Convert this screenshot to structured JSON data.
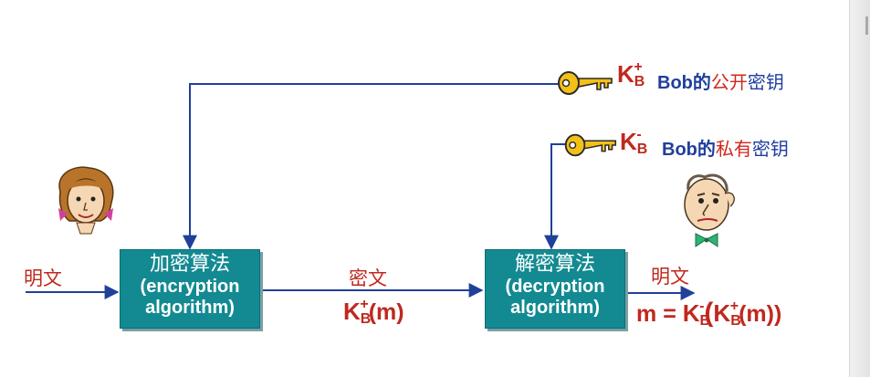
{
  "enc_box": {
    "zh": "加密算法",
    "en1": "(encryption",
    "en2": "algorithm)"
  },
  "dec_box": {
    "zh": "解密算法",
    "en1": "(decryption",
    "en2": "algorithm)"
  },
  "plaintext_in": "明文",
  "ciphertext_label": "密文",
  "plaintext_out": "明文",
  "cipher_formula": {
    "K": "K",
    "sub": "B",
    "sup": "+",
    "arg": "(m)"
  },
  "result_formula": {
    "m": "m",
    "eq": "=",
    "K": "K",
    "sub": "B",
    "sup1": "-",
    "open": "(",
    "sup2": "+",
    "arg": "(m))"
  },
  "public_key": {
    "K": "K",
    "sub": "B",
    "sup": "+",
    "owner": "Bob的",
    "desc1": "公开",
    "desc2": "密钥"
  },
  "private_key": {
    "K": "K",
    "sub": "B",
    "sup": "-",
    "owner": "Bob的",
    "desc1": "私有",
    "desc2": "密钥"
  },
  "colors": {
    "box": "#138a92",
    "text_red": "#c0281e",
    "text_blue": "#1f3f9e",
    "arrow": "#20409a",
    "key": "#f2c018"
  },
  "icons": [
    "alice-face-icon",
    "bob-face-icon",
    "public-key-icon",
    "private-key-icon"
  ]
}
